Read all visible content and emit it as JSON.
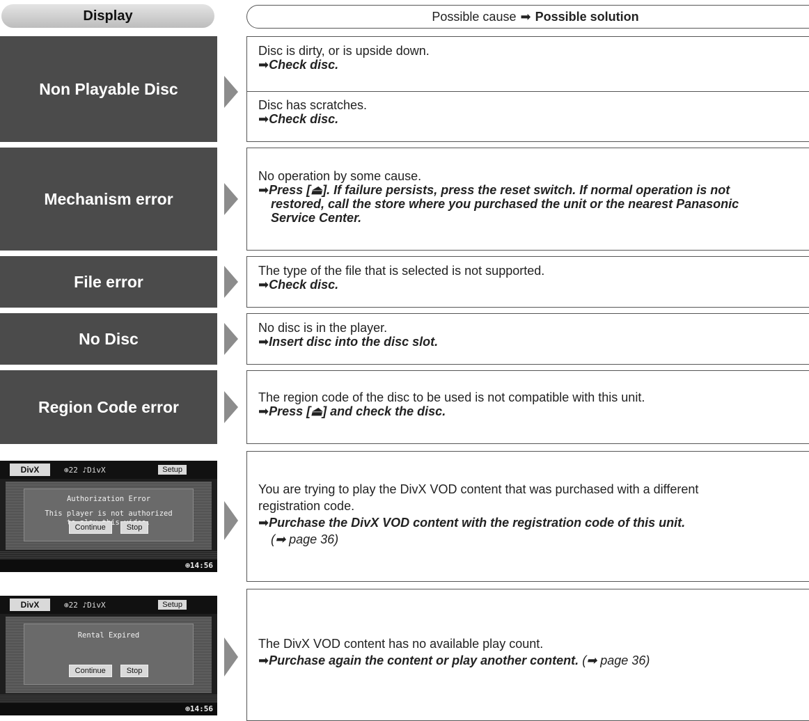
{
  "header": {
    "display_label": "Display",
    "cause_label": "Possible cause",
    "solution_label": "Possible solution",
    "arrow": "➡"
  },
  "rows": [
    {
      "display": "Non Playable Disc",
      "causes": [
        {
          "cause": "Disc is dirty, or is upside down.",
          "solution": "Check disc."
        },
        {
          "cause": "Disc has scratches.",
          "solution": "Check disc."
        }
      ]
    },
    {
      "display": "Mechanism error",
      "cause": "No operation by some cause.",
      "solution_lines": [
        "Press [⏏]. If failure persists, press the reset switch. If normal operation is not",
        "restored, call the store where you purchased the unit or the nearest Panasonic",
        "Service Center."
      ]
    },
    {
      "display": "File error",
      "cause": "The type of  the file that is selected is not supported.",
      "solution": "Check disc."
    },
    {
      "display": "No Disc",
      "cause": "No disc is in the player.",
      "solution": "Insert disc into the disc slot."
    },
    {
      "display": "Region Code error",
      "cause": "The region code of the disc to be used is not compatible with this unit.",
      "solution": "Press [⏏] and check the disc."
    },
    {
      "screen": {
        "logo": "DivX",
        "info": "⊕22  ♪DivX",
        "setup": "Setup",
        "message_lines": [
          "Authorization Error",
          "",
          "This player is not authorized",
          "to play this video."
        ],
        "btn_continue": "Continue",
        "btn_stop": "Stop",
        "clock": "⊕14:56"
      },
      "cause_lines": [
        "You are trying to play the DivX VOD content that was purchased with a different",
        "registration code."
      ],
      "solution": "Purchase the DivX VOD content with the registration code of this unit.",
      "page_ref": "(➡ page 36)"
    },
    {
      "screen": {
        "logo": "DivX",
        "info": "⊕22  ♪DivX",
        "setup": "Setup",
        "message_lines": [
          "Rental Expired"
        ],
        "btn_continue": "Continue",
        "btn_stop": "Stop",
        "clock": "⊕14:56"
      },
      "cause": "The DivX VOD content has no available play count.",
      "solution": "Purchase again the content or play another content.",
      "page_ref": "(➡ page 36)"
    }
  ]
}
